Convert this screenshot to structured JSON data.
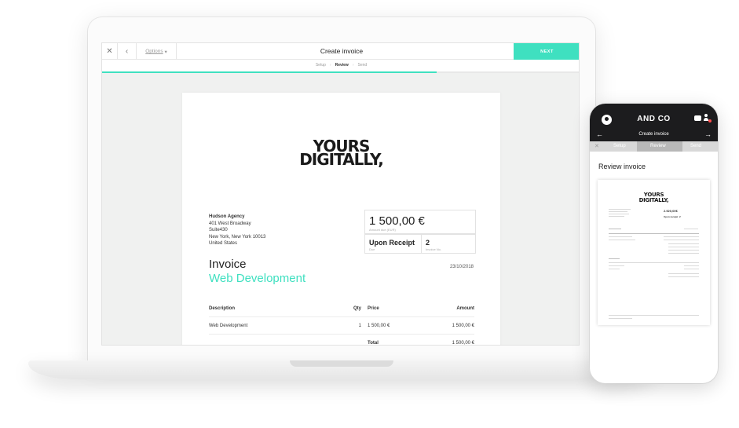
{
  "desktop": {
    "toolbar": {
      "close_icon": "✕",
      "back_icon": "‹",
      "options_label": "Options",
      "options_caret": "▾",
      "title": "Create invoice",
      "next_label": "NEXT"
    },
    "steps": [
      {
        "label": "Setup",
        "active": false
      },
      {
        "label": "Review",
        "active": true
      },
      {
        "label": "Send",
        "active": false
      }
    ],
    "step_separator": "›",
    "progress_percent": 70,
    "accent_color": "#3fe0c0",
    "invoice": {
      "logo_line1": "YOURS",
      "logo_line2": "DIGITALLY,",
      "client": {
        "name": "Hudson Agency",
        "address1": "401 West Broadway",
        "address2": "Suite430",
        "city": "New York, New York 10013",
        "country": "United States"
      },
      "amount_due": "1 500,00 €",
      "amount_due_label": "Amount due (EUR)",
      "due": "Upon Receipt",
      "due_label": "Due",
      "invoice_no": "2",
      "invoice_no_label": "Invoice No.",
      "title": "Invoice",
      "subtitle": "Web Development",
      "date": "23/10/2018",
      "table": {
        "headers": {
          "description": "Description",
          "qty": "Qty",
          "price": "Price",
          "amount": "Amount"
        },
        "rows": [
          {
            "description": "Web Development",
            "qty": "1",
            "price": "1 500,00 €",
            "amount": "1 500,00 €"
          }
        ],
        "total_label": "Total",
        "total_value": "1 500,00 €"
      }
    }
  },
  "mobile": {
    "brand": "AND CO",
    "nav_title": "Create invoice",
    "back_arrow": "←",
    "forward_arrow": "→",
    "close_icon": "✕",
    "steps": [
      "Setup",
      "Review",
      "Send"
    ],
    "active_step": "Review",
    "section_title": "Review invoice",
    "preview": {
      "logo_line1": "YOURS",
      "logo_line2": "DIGITALLY,",
      "amount": "2.920,00€",
      "due_label": "Upon receipt",
      "due_no": "2"
    }
  }
}
